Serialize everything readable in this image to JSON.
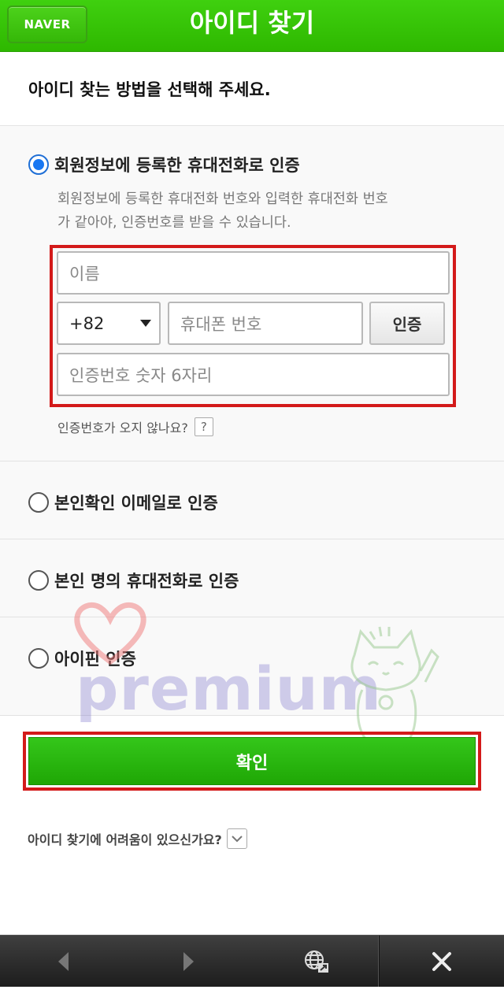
{
  "header": {
    "naver_label": "NAVER",
    "title": "아이디 찾기"
  },
  "instruction": "아이디 찾는 방법을 선택해 주세요.",
  "options": [
    {
      "label": "회원정보에 등록한 휴대전화로 인증",
      "checked": true,
      "description_line1": "회원정보에 등록한 휴대전화 번호와 입력한 휴대전화 번호",
      "description_line2": "가 같아야, 인증번호를 받을 수 있습니다."
    },
    {
      "label": "본인확인 이메일로 인증",
      "checked": false
    },
    {
      "label": "본인 명의 휴대전화로 인증",
      "checked": false
    },
    {
      "label": "아이핀 인증",
      "checked": false
    }
  ],
  "form": {
    "name_placeholder": "이름",
    "country_code": "+82",
    "phone_placeholder": "휴대폰 번호",
    "auth_button": "인증",
    "code_placeholder": "인증번호 숫자 6자리"
  },
  "help_text": "인증번호가 오지 않나요?",
  "help_icon": "?",
  "confirm_label": "확인",
  "trouble_text": "아이디 찾기에 어려움이 있으신가요?",
  "watermark_text": "premium",
  "colors": {
    "naver_green": "#2eb800",
    "highlight_red": "#d31a1a",
    "radio_blue": "#1877f2"
  },
  "bottom_bar": {
    "icons": [
      "back-icon",
      "forward-icon",
      "globe-icon",
      "close-icon"
    ]
  }
}
